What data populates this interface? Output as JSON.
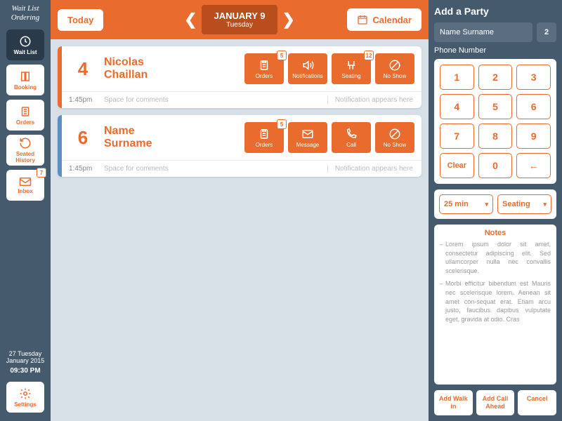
{
  "app": {
    "name": "Wait List Ordering"
  },
  "sidebar": {
    "items": [
      {
        "label": "Wait List",
        "icon": "clock",
        "active": true
      },
      {
        "label": "Booking",
        "icon": "book"
      },
      {
        "label": "Orders",
        "icon": "clipboard"
      },
      {
        "label": "Seated History",
        "icon": "history"
      },
      {
        "label": "Inbox",
        "icon": "mail",
        "badge": "7"
      },
      {
        "label": "Settings",
        "icon": "gear"
      }
    ],
    "date": "27 Tuesday January 2015",
    "time": "09:30 PM"
  },
  "topbar": {
    "today": "Today",
    "calendar": "Calendar",
    "date_main": "JANUARY 9",
    "date_sub": "Tuesday"
  },
  "parties": [
    {
      "bar_color": "orange",
      "size": "4",
      "name": "Nicolas Chaillan",
      "time": "1:45pm",
      "comment_placeholder": "Space for comments",
      "notif_placeholder": "Notification appears here",
      "actions": [
        {
          "label": "Orders",
          "icon": "clipboard",
          "badge": "5"
        },
        {
          "label": "Notifications",
          "icon": "sound"
        },
        {
          "label": "Seating",
          "icon": "chair",
          "badge": "12"
        },
        {
          "label": "No Show",
          "icon": "noshow"
        }
      ]
    },
    {
      "bar_color": "blue",
      "size": "6",
      "name": "Name Surname",
      "time": "1:45pm",
      "comment_placeholder": "Space for comments",
      "notif_placeholder": "Notification appears here",
      "actions": [
        {
          "label": "Orders",
          "icon": "clipboard",
          "badge": "5"
        },
        {
          "label": "Message",
          "icon": "mail"
        },
        {
          "label": "Call",
          "icon": "phone"
        },
        {
          "label": "No Show",
          "icon": "noshow"
        }
      ]
    }
  ],
  "rpanel": {
    "title": "Add a Party",
    "name": "Name Surname",
    "count": "2",
    "phone_label": "Phone Number",
    "keys": [
      "1",
      "2",
      "3",
      "4",
      "5",
      "6",
      "7",
      "8",
      "9",
      "Clear",
      "0",
      "←"
    ],
    "wait": "25 min",
    "seating": "Seating",
    "notes_title": "Notes",
    "notes": [
      "Lorem ipsum dolor sit amet, consectetur adipiscing elit. Sed ullamcorper nulla nec convallis scelerisque.",
      "Morbi efficitur bibendum est Mauris nec scelerisque lorem. Aenean sit amet con-sequat erat. Etiam arcu justo, faucibus dapibus vulputate eget, gravida at odio. Cras"
    ],
    "btn_walkin": "Add Walk in",
    "btn_callahead": "Add Call Ahead",
    "btn_cancel": "Cancel"
  },
  "icons": {
    "clock": "◷",
    "book": "▢",
    "clipboard": "▤",
    "history": "↻",
    "mail": "✉",
    "gear": "⚙",
    "sound": "♪",
    "chair": "⊓",
    "noshow": "⊘",
    "phone": "✆",
    "calendar": "▦",
    "chevdown": "˅"
  }
}
